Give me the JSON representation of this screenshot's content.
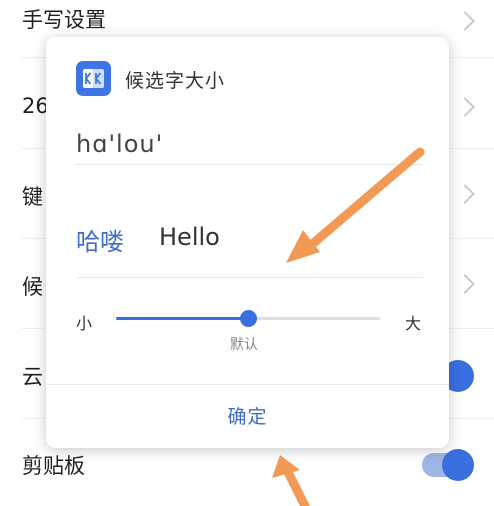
{
  "settings": {
    "rows": [
      {
        "label": "手写设置",
        "control": "chevron"
      },
      {
        "label": "26",
        "control": "chevron"
      },
      {
        "label": "键",
        "control": "chevron"
      },
      {
        "label": "候",
        "control": "chevron"
      },
      {
        "label": "云",
        "control": "toggle",
        "toggle_on": true
      },
      {
        "label": "剪贴板",
        "control": "toggle",
        "toggle_on": true
      }
    ]
  },
  "dialog": {
    "logo_icon": "keyboard-app-logo-icon",
    "title": "候选字大小",
    "pinyin_input": "hɑ'lou'",
    "candidates": [
      "哈喽",
      "Hello"
    ],
    "slider": {
      "min_label": "小",
      "max_label": "大",
      "value_fraction": 0.5,
      "value_caption": "默认"
    },
    "confirm_label": "确定"
  },
  "colors": {
    "accent": "#3a6fe0",
    "candidate_primary": "#3d6ec9",
    "annotation_arrow": "#f29a55"
  }
}
